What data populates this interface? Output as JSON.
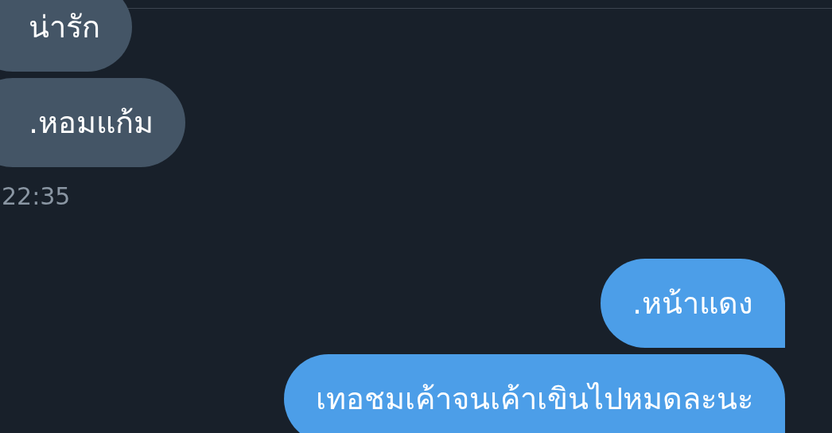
{
  "messages": [
    {
      "kind": "received",
      "text": "น่ารัก"
    },
    {
      "kind": "received",
      "text": ".หอมแก้ม"
    },
    {
      "kind": "time",
      "text": "22:35"
    },
    {
      "kind": "sent",
      "text": ".หน้าแดง"
    },
    {
      "kind": "sent",
      "text": "เทอชมเค้าจนเค้าเขินไปหมดละนะ"
    }
  ]
}
